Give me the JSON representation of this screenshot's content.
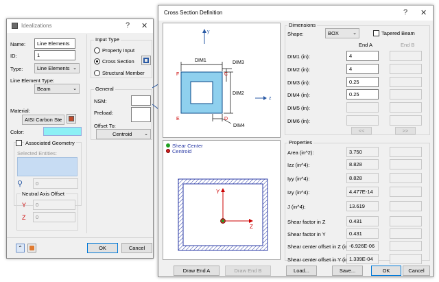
{
  "ideal": {
    "title": "Idealizations",
    "name_label": "Name:",
    "name_value": "Line Elements",
    "id_label": "ID:",
    "id_value": "1",
    "type_label": "Type:",
    "type_value": "Line Elements",
    "line_type_label": "Line Element Type:",
    "line_type_value": "Beam",
    "material_label": "Material:",
    "material_value": "AISI Carbon Ste",
    "color_label": "Color:",
    "color_value": "#8cf0f5",
    "assoc_label": "Associated Geometry",
    "selected_label": "Selected Entities:",
    "count_value": "0",
    "neutral_label": "Neutral Axis Offset",
    "y_label": "Y",
    "y_value": "0",
    "z_label": "Z",
    "z_value": "0",
    "input_type_label": "Input Type",
    "radio_property": "Property Input",
    "radio_cross": "Cross Section",
    "radio_member": "Structural Member",
    "general_label": "General",
    "nsm_label": "NSM:",
    "preload_label": "Preload:",
    "offset_label": "Offset To:",
    "offset_value": "Centroid",
    "ok": "OK",
    "cancel": "Cancel"
  },
  "csd": {
    "title": "Cross Section Definition",
    "axis_y": "y",
    "axis_z": "z",
    "dim1": "DIM1",
    "dim2": "DIM2",
    "dim3": "DIM3",
    "dim4": "DIM4",
    "pt_c": "C",
    "pt_d": "D",
    "pt_e": "E",
    "pt_f": "F",
    "legend_shear": "Shear Center",
    "legend_centroid": "Centroid",
    "plot_y": "Y",
    "plot_z": "Z",
    "dimensions_label": "Dimensions",
    "shape_label": "Shape:",
    "shape_value": "BOX",
    "tapered_label": "Tapered Beam",
    "end_a": "End A",
    "end_b": "End B",
    "dims": [
      {
        "label": "DIM1 (in):",
        "a": "4"
      },
      {
        "label": "DIM2 (in):",
        "a": "4"
      },
      {
        "label": "DIM3 (in):",
        "a": "0.25"
      },
      {
        "label": "DIM4 (in):",
        "a": "0.25"
      },
      {
        "label": "DIM5 (in):",
        "a": ""
      },
      {
        "label": "DIM6 (in):",
        "a": ""
      }
    ],
    "copy_left": "<<",
    "copy_right": ">>",
    "properties_label": "Properties",
    "props": [
      {
        "label": "Area (in^2):",
        "a": "3.750"
      },
      {
        "label": "Izz (in^4):",
        "a": "8.828"
      },
      {
        "label": "Iyy (in^4):",
        "a": "8.828"
      },
      {
        "label": "Izy (in^4):",
        "a": "4.477E-14"
      },
      {
        "label": "J (in^4):",
        "a": "13.619"
      },
      {
        "label": "Shear factor in Z",
        "a": "0.431"
      },
      {
        "label": "Shear factor in Y",
        "a": "0.431"
      },
      {
        "label": "Shear center offset in Z (in):",
        "a": "-6.926E-06"
      },
      {
        "label": "Shear center offset in Y (in):",
        "a": "1.339E-04"
      }
    ],
    "draw_a": "Draw End A",
    "draw_b": "Draw End B",
    "load": "Load...",
    "save": "Save...",
    "ok": "OK",
    "cancel": "Cancel"
  }
}
